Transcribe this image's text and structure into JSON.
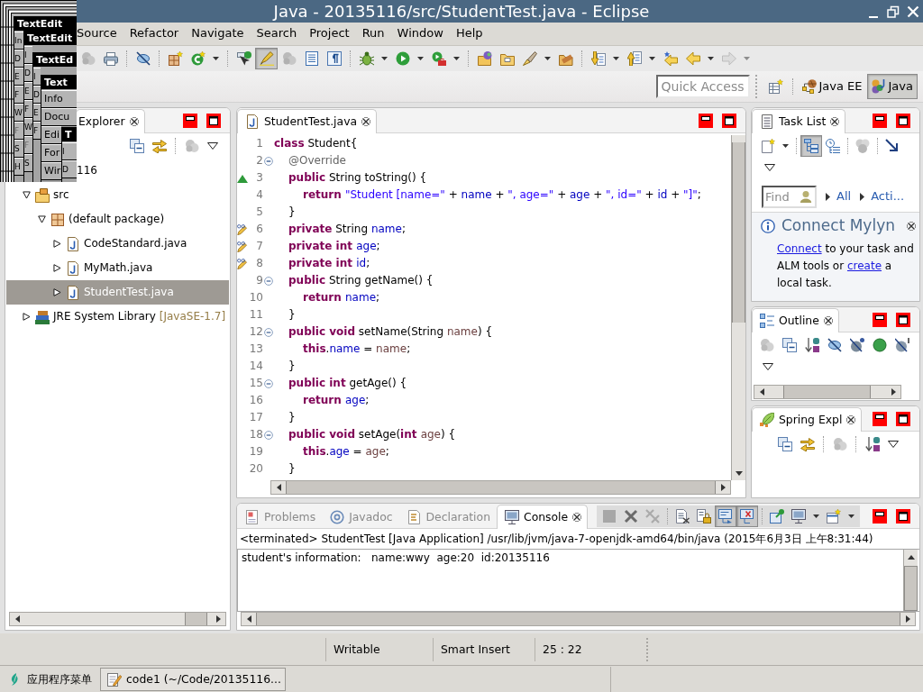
{
  "window": {
    "title": "Java - 20135116/src/StudentTest.java - Eclipse"
  },
  "overlay_windows": [
    {
      "title": "TextEdit",
      "menu": [
        {
          "label": "In",
          "disabled": false
        },
        {
          "label": "D",
          "disabled": false
        },
        {
          "label": "E",
          "disabled": false
        },
        {
          "label": "F",
          "disabled": false
        },
        {
          "label": "W",
          "disabled": false
        },
        {
          "label": "F",
          "disabled": true
        },
        {
          "label": "S",
          "disabled": false
        },
        {
          "label": "H",
          "disabled": false
        }
      ]
    },
    {
      "title": "TextEdit",
      "menu": [
        {
          "label": "I",
          "disabled": false
        },
        {
          "label": "D",
          "disabled": false
        },
        {
          "label": "E",
          "disabled": false
        },
        {
          "label": "F",
          "disabled": false
        },
        {
          "label": "W",
          "disabled": false
        },
        {
          "label": "F",
          "disabled": true
        },
        {
          "label": "S",
          "disabled": false
        }
      ]
    },
    {
      "title": "TextEd",
      "menu": [
        {
          "label": "I",
          "disabled": false
        },
        {
          "label": "D",
          "disabled": false
        },
        {
          "label": "E",
          "disabled": false
        },
        {
          "label": "F",
          "disabled": false
        }
      ]
    },
    {
      "title": "Text",
      "menu": [
        {
          "label": "Info",
          "disabled": false
        },
        {
          "label": "Docu",
          "disabled": false
        },
        {
          "label": "Edi",
          "disabled": false
        },
        {
          "label": "For",
          "disabled": false
        },
        {
          "label": "Wir",
          "disabled": false
        }
      ]
    },
    {
      "title": "T",
      "menu": [
        {
          "label": "I",
          "disabled": false
        },
        {
          "label": "D",
          "disabled": false
        }
      ]
    }
  ],
  "menu": [
    "Source",
    "Refactor",
    "Navigate",
    "Search",
    "Project",
    "Run",
    "Window",
    "Help"
  ],
  "toolbar": [
    {
      "kind": "button",
      "pressed": false,
      "disabled": true
    },
    {
      "kind": "button",
      "pressed": false,
      "disabled": false
    },
    {
      "kind": "separator"
    },
    {
      "kind": "button",
      "pressed": false,
      "disabled": false
    },
    {
      "kind": "separator"
    },
    {
      "kind": "button",
      "pressed": false,
      "disabled": false
    },
    {
      "kind": "button",
      "pressed": false,
      "disabled": false
    },
    {
      "kind": "dropdown",
      "disabled": false
    },
    {
      "kind": "separator"
    },
    {
      "kind": "button",
      "pressed": false,
      "disabled": false
    },
    {
      "kind": "button",
      "pressed": true,
      "disabled": false
    },
    {
      "kind": "button",
      "pressed": false,
      "disabled": true
    },
    {
      "kind": "button",
      "pressed": false,
      "disabled": false
    },
    {
      "kind": "button",
      "pressed": false,
      "disabled": false
    },
    {
      "kind": "separator"
    },
    {
      "kind": "button",
      "pressed": false,
      "disabled": false
    },
    {
      "kind": "dropdown",
      "disabled": false
    },
    {
      "kind": "button",
      "pressed": false,
      "disabled": false
    },
    {
      "kind": "dropdown",
      "disabled": false
    },
    {
      "kind": "button",
      "pressed": false,
      "disabled": false
    },
    {
      "kind": "dropdown",
      "disabled": false
    },
    {
      "kind": "separator"
    },
    {
      "kind": "button",
      "pressed": false,
      "disabled": false
    },
    {
      "kind": "button",
      "pressed": false,
      "disabled": false
    },
    {
      "kind": "button",
      "pressed": false,
      "disabled": false
    },
    {
      "kind": "dropdown",
      "disabled": false
    },
    {
      "kind": "button",
      "pressed": false,
      "disabled": false
    },
    {
      "kind": "separator"
    },
    {
      "kind": "button",
      "pressed": false,
      "disabled": false
    },
    {
      "kind": "dropdown",
      "disabled": false
    },
    {
      "kind": "button",
      "pressed": false,
      "disabled": false
    },
    {
      "kind": "dropdown",
      "disabled": false
    },
    {
      "kind": "button",
      "pressed": false,
      "disabled": false
    },
    {
      "kind": "button",
      "pressed": false,
      "disabled": false
    },
    {
      "kind": "dropdown",
      "disabled": false
    },
    {
      "kind": "button",
      "pressed": false,
      "disabled": true
    },
    {
      "kind": "dropdown",
      "disabled": true
    }
  ],
  "quick_access": {
    "placeholder": "Quick Access"
  },
  "perspectives": [
    {
      "label": "Java EE",
      "selected": false
    },
    {
      "label": "Java",
      "selected": true
    }
  ],
  "package_explorer": {
    "title": "Explorer",
    "toolbar": [
      {
        "kind": "button",
        "pressed": false,
        "disabled": false
      },
      {
        "kind": "button",
        "pressed": false,
        "disabled": false
      },
      {
        "kind": "separator"
      },
      {
        "kind": "button",
        "pressed": false,
        "disabled": true
      },
      {
        "kind": "menu"
      }
    ],
    "tree": [
      {
        "label": "116",
        "selected": false,
        "children": [
          {
            "label": "src",
            "kind": "source_folder",
            "expanded": true,
            "selected": false,
            "children": [
              {
                "label": "(default package)",
                "kind": "package",
                "expanded": true,
                "selected": false,
                "children": [
                  {
                    "label": "CodeStandard.java",
                    "kind": "java_file",
                    "expanded": false,
                    "selected": false
                  },
                  {
                    "label": "MyMath.java",
                    "kind": "java_file",
                    "expanded": false,
                    "selected": false
                  },
                  {
                    "label": "StudentTest.java",
                    "kind": "java_file",
                    "expanded": false,
                    "selected": true
                  }
                ]
              }
            ]
          },
          {
            "label": "JRE System Library",
            "decoration": "[JavaSE-1.7]",
            "kind": "library",
            "expanded": false,
            "selected": false
          }
        ]
      }
    ]
  },
  "editor": {
    "tab": "StudentTest.java",
    "lines": [
      {
        "number": "1",
        "kind": "plain",
        "fold": false,
        "tokens": [
          {
            "text": "class",
            "kind": "keyword"
          },
          {
            "text": " Student{",
            "kind": "plain"
          }
        ]
      },
      {
        "number": "2",
        "kind": "plain",
        "fold": true,
        "tokens": [
          {
            "text": "\t@Override",
            "kind": "annotation"
          }
        ]
      },
      {
        "number": "3",
        "kind": "override",
        "fold": false,
        "tokens": [
          {
            "text": "\tpublic",
            "kind": "keyword"
          },
          {
            "text": " String toString() {",
            "kind": "plain"
          }
        ]
      },
      {
        "number": "4",
        "kind": "plain",
        "fold": false,
        "tokens": [
          {
            "text": "\t\treturn ",
            "kind": "keyword"
          },
          {
            "text": "\"Student [name=\"",
            "kind": "string"
          },
          {
            "text": " + ",
            "kind": "plain"
          },
          {
            "text": "name",
            "kind": "field"
          },
          {
            "text": " + ",
            "kind": "plain"
          },
          {
            "text": "\", age=\"",
            "kind": "string"
          },
          {
            "text": " + ",
            "kind": "plain"
          },
          {
            "text": "age",
            "kind": "field"
          },
          {
            "text": " + ",
            "kind": "plain"
          },
          {
            "text": "\", id=\"",
            "kind": "string"
          },
          {
            "text": " + ",
            "kind": "plain"
          },
          {
            "text": "id",
            "kind": "field"
          },
          {
            "text": " + ",
            "kind": "plain"
          },
          {
            "text": "\"]\"",
            "kind": "string"
          },
          {
            "text": ";",
            "kind": "plain"
          }
        ]
      },
      {
        "number": "5",
        "kind": "plain",
        "fold": false,
        "tokens": [
          {
            "text": "\t}",
            "kind": "plain"
          }
        ]
      },
      {
        "number": "6",
        "kind": "edit",
        "fold": false,
        "tokens": [
          {
            "text": "\tprivate",
            "kind": "keyword"
          },
          {
            "text": " String ",
            "kind": "plain"
          },
          {
            "text": "name",
            "kind": "field"
          },
          {
            "text": ";",
            "kind": "plain"
          }
        ]
      },
      {
        "number": "7",
        "kind": "edit",
        "fold": false,
        "tokens": [
          {
            "text": "\tprivate int ",
            "kind": "keyword"
          },
          {
            "text": "age",
            "kind": "field"
          },
          {
            "text": ";",
            "kind": "plain"
          }
        ]
      },
      {
        "number": "8",
        "kind": "edit",
        "fold": false,
        "tokens": [
          {
            "text": "\tprivate int ",
            "kind": "keyword"
          },
          {
            "text": "id",
            "kind": "field"
          },
          {
            "text": ";",
            "kind": "plain"
          }
        ]
      },
      {
        "number": "9",
        "kind": "plain",
        "fold": true,
        "tokens": [
          {
            "text": "\tpublic",
            "kind": "keyword"
          },
          {
            "text": " String getName() {",
            "kind": "plain"
          }
        ]
      },
      {
        "number": "10",
        "kind": "plain",
        "fold": false,
        "tokens": [
          {
            "text": "\t\treturn ",
            "kind": "keyword"
          },
          {
            "text": "name",
            "kind": "field"
          },
          {
            "text": ";",
            "kind": "plain"
          }
        ]
      },
      {
        "number": "11",
        "kind": "plain",
        "fold": false,
        "tokens": [
          {
            "text": "\t}",
            "kind": "plain"
          }
        ]
      },
      {
        "number": "12",
        "kind": "plain",
        "fold": true,
        "tokens": [
          {
            "text": "\tpublic void",
            "kind": "keyword"
          },
          {
            "text": " setName(String ",
            "kind": "plain"
          },
          {
            "text": "name",
            "kind": "parameter"
          },
          {
            "text": ") {",
            "kind": "plain"
          }
        ]
      },
      {
        "number": "13",
        "kind": "plain",
        "fold": false,
        "tokens": [
          {
            "text": "\t\tthis",
            "kind": "keyword"
          },
          {
            "text": ".",
            "kind": "plain"
          },
          {
            "text": "name",
            "kind": "field"
          },
          {
            "text": " = ",
            "kind": "plain"
          },
          {
            "text": "name",
            "kind": "parameter"
          },
          {
            "text": ";",
            "kind": "plain"
          }
        ]
      },
      {
        "number": "14",
        "kind": "plain",
        "fold": false,
        "tokens": [
          {
            "text": "\t}",
            "kind": "plain"
          }
        ]
      },
      {
        "number": "15",
        "kind": "plain",
        "fold": true,
        "tokens": [
          {
            "text": "\tpublic int",
            "kind": "keyword"
          },
          {
            "text": " getAge() {",
            "kind": "plain"
          }
        ]
      },
      {
        "number": "16",
        "kind": "plain",
        "fold": false,
        "tokens": [
          {
            "text": "\t\treturn ",
            "kind": "keyword"
          },
          {
            "text": "age",
            "kind": "field"
          },
          {
            "text": ";",
            "kind": "plain"
          }
        ]
      },
      {
        "number": "17",
        "kind": "plain",
        "fold": false,
        "tokens": [
          {
            "text": "\t}",
            "kind": "plain"
          }
        ]
      },
      {
        "number": "18",
        "kind": "plain",
        "fold": true,
        "tokens": [
          {
            "text": "\tpublic void",
            "kind": "keyword"
          },
          {
            "text": " setAge(",
            "kind": "plain"
          },
          {
            "text": "int ",
            "kind": "keyword"
          },
          {
            "text": "age",
            "kind": "parameter"
          },
          {
            "text": ") {",
            "kind": "plain"
          }
        ]
      },
      {
        "number": "19",
        "kind": "plain",
        "fold": false,
        "tokens": [
          {
            "text": "\t\tthis",
            "kind": "keyword"
          },
          {
            "text": ".",
            "kind": "plain"
          },
          {
            "text": "age",
            "kind": "field"
          },
          {
            "text": " = ",
            "kind": "plain"
          },
          {
            "text": "age",
            "kind": "parameter"
          },
          {
            "text": ";",
            "kind": "plain"
          }
        ]
      },
      {
        "number": "20",
        "kind": "plain",
        "fold": false,
        "tokens": [
          {
            "text": "\t}",
            "kind": "plain"
          }
        ]
      }
    ]
  },
  "task_list": {
    "title": "Task List",
    "toolbar": [
      {
        "kind": "button",
        "pressed": false,
        "disabled": false
      },
      {
        "kind": "dropdown",
        "disabled": false
      },
      {
        "kind": "separator"
      },
      {
        "kind": "button",
        "pressed": true,
        "disabled": false
      },
      {
        "kind": "button",
        "pressed": false,
        "disabled": false
      },
      {
        "kind": "separator"
      },
      {
        "kind": "button",
        "pressed": false,
        "disabled": true
      },
      {
        "kind": "separator"
      },
      {
        "kind": "button",
        "pressed": false,
        "disabled": false
      },
      {
        "kind": "menu"
      }
    ],
    "find": {
      "placeholder": "Find"
    },
    "filters": [
      {
        "label": "All"
      },
      {
        "label": "Acti..."
      }
    ],
    "mylyn": {
      "heading": "Connect Mylyn",
      "message": [
        {
          "text": "Connect",
          "kind": "link"
        },
        {
          "text": " to your task and ALM tools or ",
          "kind": "text"
        },
        {
          "text": "create",
          "kind": "link"
        },
        {
          "text": " a local task.",
          "kind": "text"
        }
      ]
    }
  },
  "outline": {
    "title": "Outline",
    "toolbar": [
      {
        "kind": "button",
        "pressed": false,
        "disabled": true
      },
      {
        "kind": "button",
        "pressed": false,
        "disabled": false
      },
      {
        "kind": "button",
        "pressed": false,
        "disabled": false
      },
      {
        "kind": "button",
        "pressed": false,
        "disabled": false
      },
      {
        "kind": "button",
        "pressed": false,
        "disabled": false
      },
      {
        "kind": "button",
        "pressed": false,
        "disabled": false
      },
      {
        "kind": "button",
        "pressed": false,
        "disabled": false
      },
      {
        "kind": "menu"
      }
    ]
  },
  "spring_explorer": {
    "title": "Spring Expl",
    "toolbar": [
      {
        "kind": "button",
        "pressed": false,
        "disabled": false
      },
      {
        "kind": "button",
        "pressed": false,
        "disabled": false
      },
      {
        "kind": "separator"
      },
      {
        "kind": "button",
        "pressed": false,
        "disabled": true
      },
      {
        "kind": "separator"
      },
      {
        "kind": "button",
        "pressed": false,
        "disabled": false
      },
      {
        "kind": "menu"
      }
    ]
  },
  "console": {
    "tabs": [
      {
        "label": "Problems",
        "selected": false
      },
      {
        "label": "Javadoc",
        "selected": false
      },
      {
        "label": "Declaration",
        "selected": false
      },
      {
        "label": "Console",
        "selected": true
      }
    ],
    "toolbar": [
      {
        "kind": "button",
        "pressed": false,
        "disabled": true
      },
      {
        "kind": "button",
        "pressed": false,
        "disabled": false
      },
      {
        "kind": "button",
        "pressed": false,
        "disabled": true
      },
      {
        "kind": "separator"
      },
      {
        "kind": "button",
        "pressed": false,
        "disabled": false
      },
      {
        "kind": "button",
        "pressed": false,
        "disabled": false
      },
      {
        "kind": "button",
        "pressed": true,
        "disabled": false
      },
      {
        "kind": "button",
        "pressed": true,
        "disabled": false
      },
      {
        "kind": "separator"
      },
      {
        "kind": "button",
        "pressed": false,
        "disabled": false
      },
      {
        "kind": "button",
        "pressed": false,
        "disabled": false
      },
      {
        "kind": "dropdown",
        "disabled": false
      },
      {
        "kind": "button",
        "pressed": false,
        "disabled": false
      },
      {
        "kind": "dropdown",
        "disabled": false
      }
    ],
    "header": "<terminated> StudentTest [Java Application] /usr/lib/jvm/java-7-openjdk-amd64/bin/java (2015年6月3日 上午8:31:44)",
    "output": "student's information:   name:wwy  age:20  id:20135116"
  },
  "status_bar": [
    "Writable",
    "Smart Insert",
    "25 : 22"
  ],
  "taskbar": {
    "start_label": "应用程序菜单",
    "tasks": [
      {
        "label": "code1 (~/Code/20135116..."
      }
    ]
  }
}
